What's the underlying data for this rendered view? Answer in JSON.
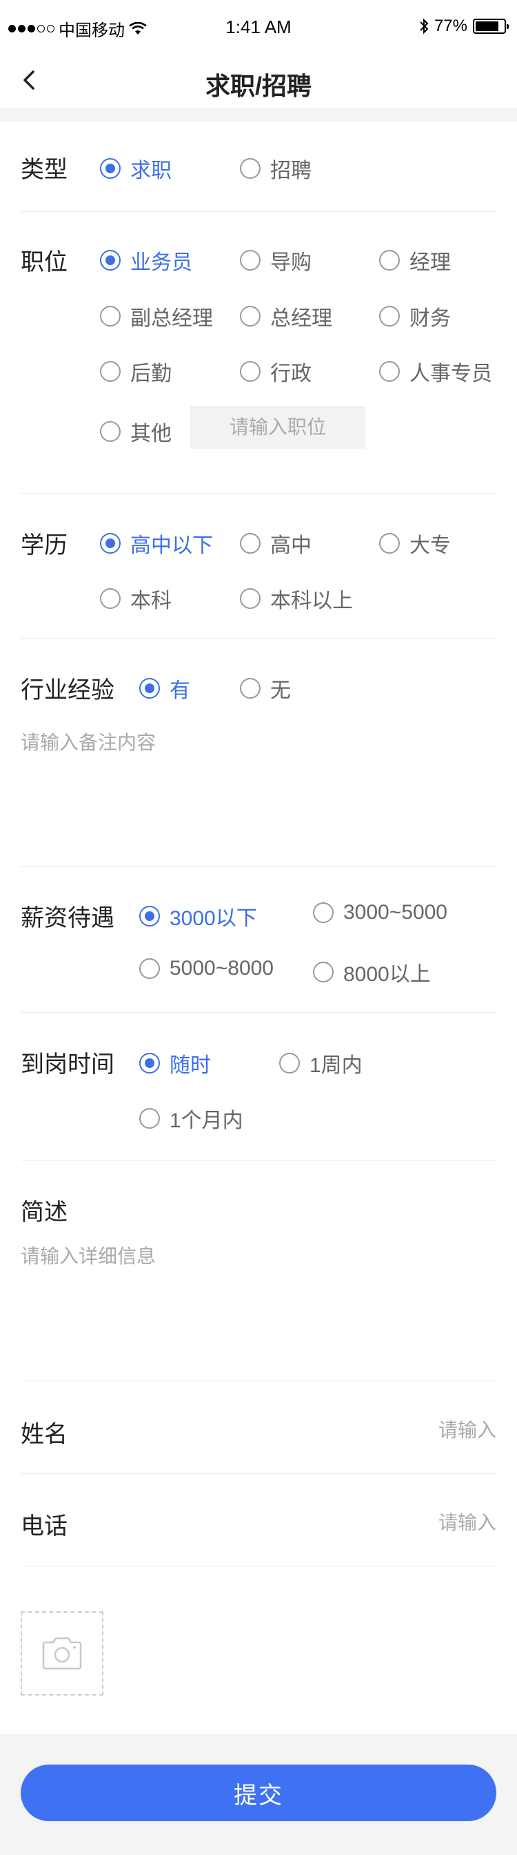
{
  "status_bar": {
    "carrier": "中国移动",
    "time": "1:41 AM",
    "battery": "77%"
  },
  "nav": {
    "title": "求职/招聘"
  },
  "type": {
    "label": "类型",
    "options": [
      "求职",
      "招聘"
    ],
    "selected": 0
  },
  "position": {
    "label": "职位",
    "options": [
      "业务员",
      "导购",
      "经理",
      "副总经理",
      "总经理",
      "财务",
      "后勤",
      "行政",
      "人事专员",
      "其他"
    ],
    "selected": 0,
    "other_placeholder": "请输入职位"
  },
  "education": {
    "label": "学历",
    "options": [
      "高中以下",
      "高中",
      "大专",
      "本科",
      "本科以上"
    ],
    "selected": 0
  },
  "experience": {
    "label": "行业经验",
    "options": [
      "有",
      "无"
    ],
    "selected": 0,
    "note_placeholder": "请输入备注内容"
  },
  "salary": {
    "label": "薪资待遇",
    "options": [
      "3000以下",
      "3000~5000",
      "5000~8000",
      "8000以上"
    ],
    "selected": 0
  },
  "arrival": {
    "label": "到岗时间",
    "options": [
      "随时",
      "1周内",
      "1个月内"
    ],
    "selected": 0
  },
  "summary": {
    "label": "简述",
    "placeholder": "请输入详细信息"
  },
  "name": {
    "label": "姓名",
    "placeholder": "请输入"
  },
  "phone": {
    "label": "电话",
    "placeholder": "请输入"
  },
  "photo": {
    "icon": "camera-icon"
  },
  "submit_label": "提交",
  "colors": {
    "accent": "#3d6fe8",
    "button": "#3f72f3"
  }
}
